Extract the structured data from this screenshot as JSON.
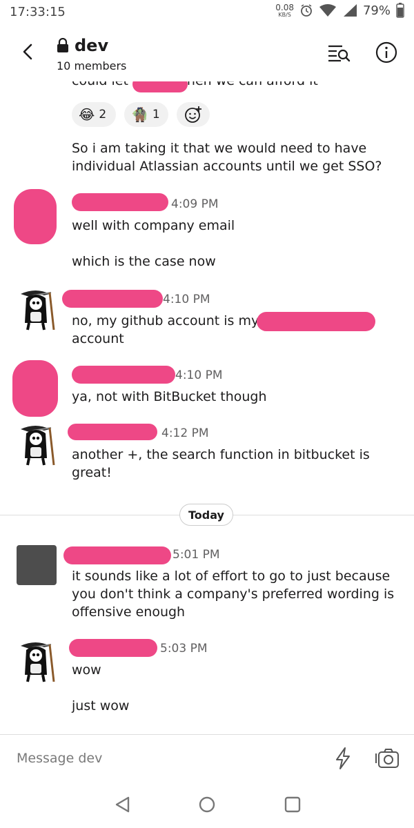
{
  "status_bar": {
    "time": "17:33:15",
    "net_speed_value": "0.08",
    "net_speed_unit": "KB/S",
    "battery": "79%"
  },
  "header": {
    "channel": "dev",
    "members": "10 members",
    "icons": [
      "back-icon",
      "lock-icon",
      "search-list-icon",
      "info-icon"
    ]
  },
  "feed": {
    "cut_text": "could let           go and then we can afford it",
    "reactions": [
      {
        "emoji": "😂",
        "count": "2"
      },
      {
        "emoji": "🧌",
        "count": "1"
      }
    ],
    "messages": [
      {
        "text": "So i am taking it that we would need to have individual Atlassian accounts until we get SSO?"
      },
      {
        "time": "4:09 PM",
        "text1": "well with company email",
        "text2": "which is the case now"
      },
      {
        "time": "4:10 PM",
        "text1": "no, my github account is my",
        "text2": "account"
      },
      {
        "time": "4:10 PM",
        "text1": "ya, not with BitBucket though"
      },
      {
        "time": "4:12 PM",
        "text1": "another +, the search function in bitbucket is",
        "text2": "great!"
      },
      {
        "time": "5:01 PM",
        "text1": "it sounds like a lot of effort to go to just because",
        "text2": "you don't think a company's preferred wording is",
        "text3": "offensive enough"
      },
      {
        "time": "5:03 PM",
        "text1": "wow",
        "text2": "just wow"
      }
    ],
    "day_divider": "Today"
  },
  "composer": {
    "placeholder": "Message dev"
  },
  "colors": {
    "redaction": "#ee4886",
    "text": "#1d1c1d",
    "muted": "#616061"
  }
}
